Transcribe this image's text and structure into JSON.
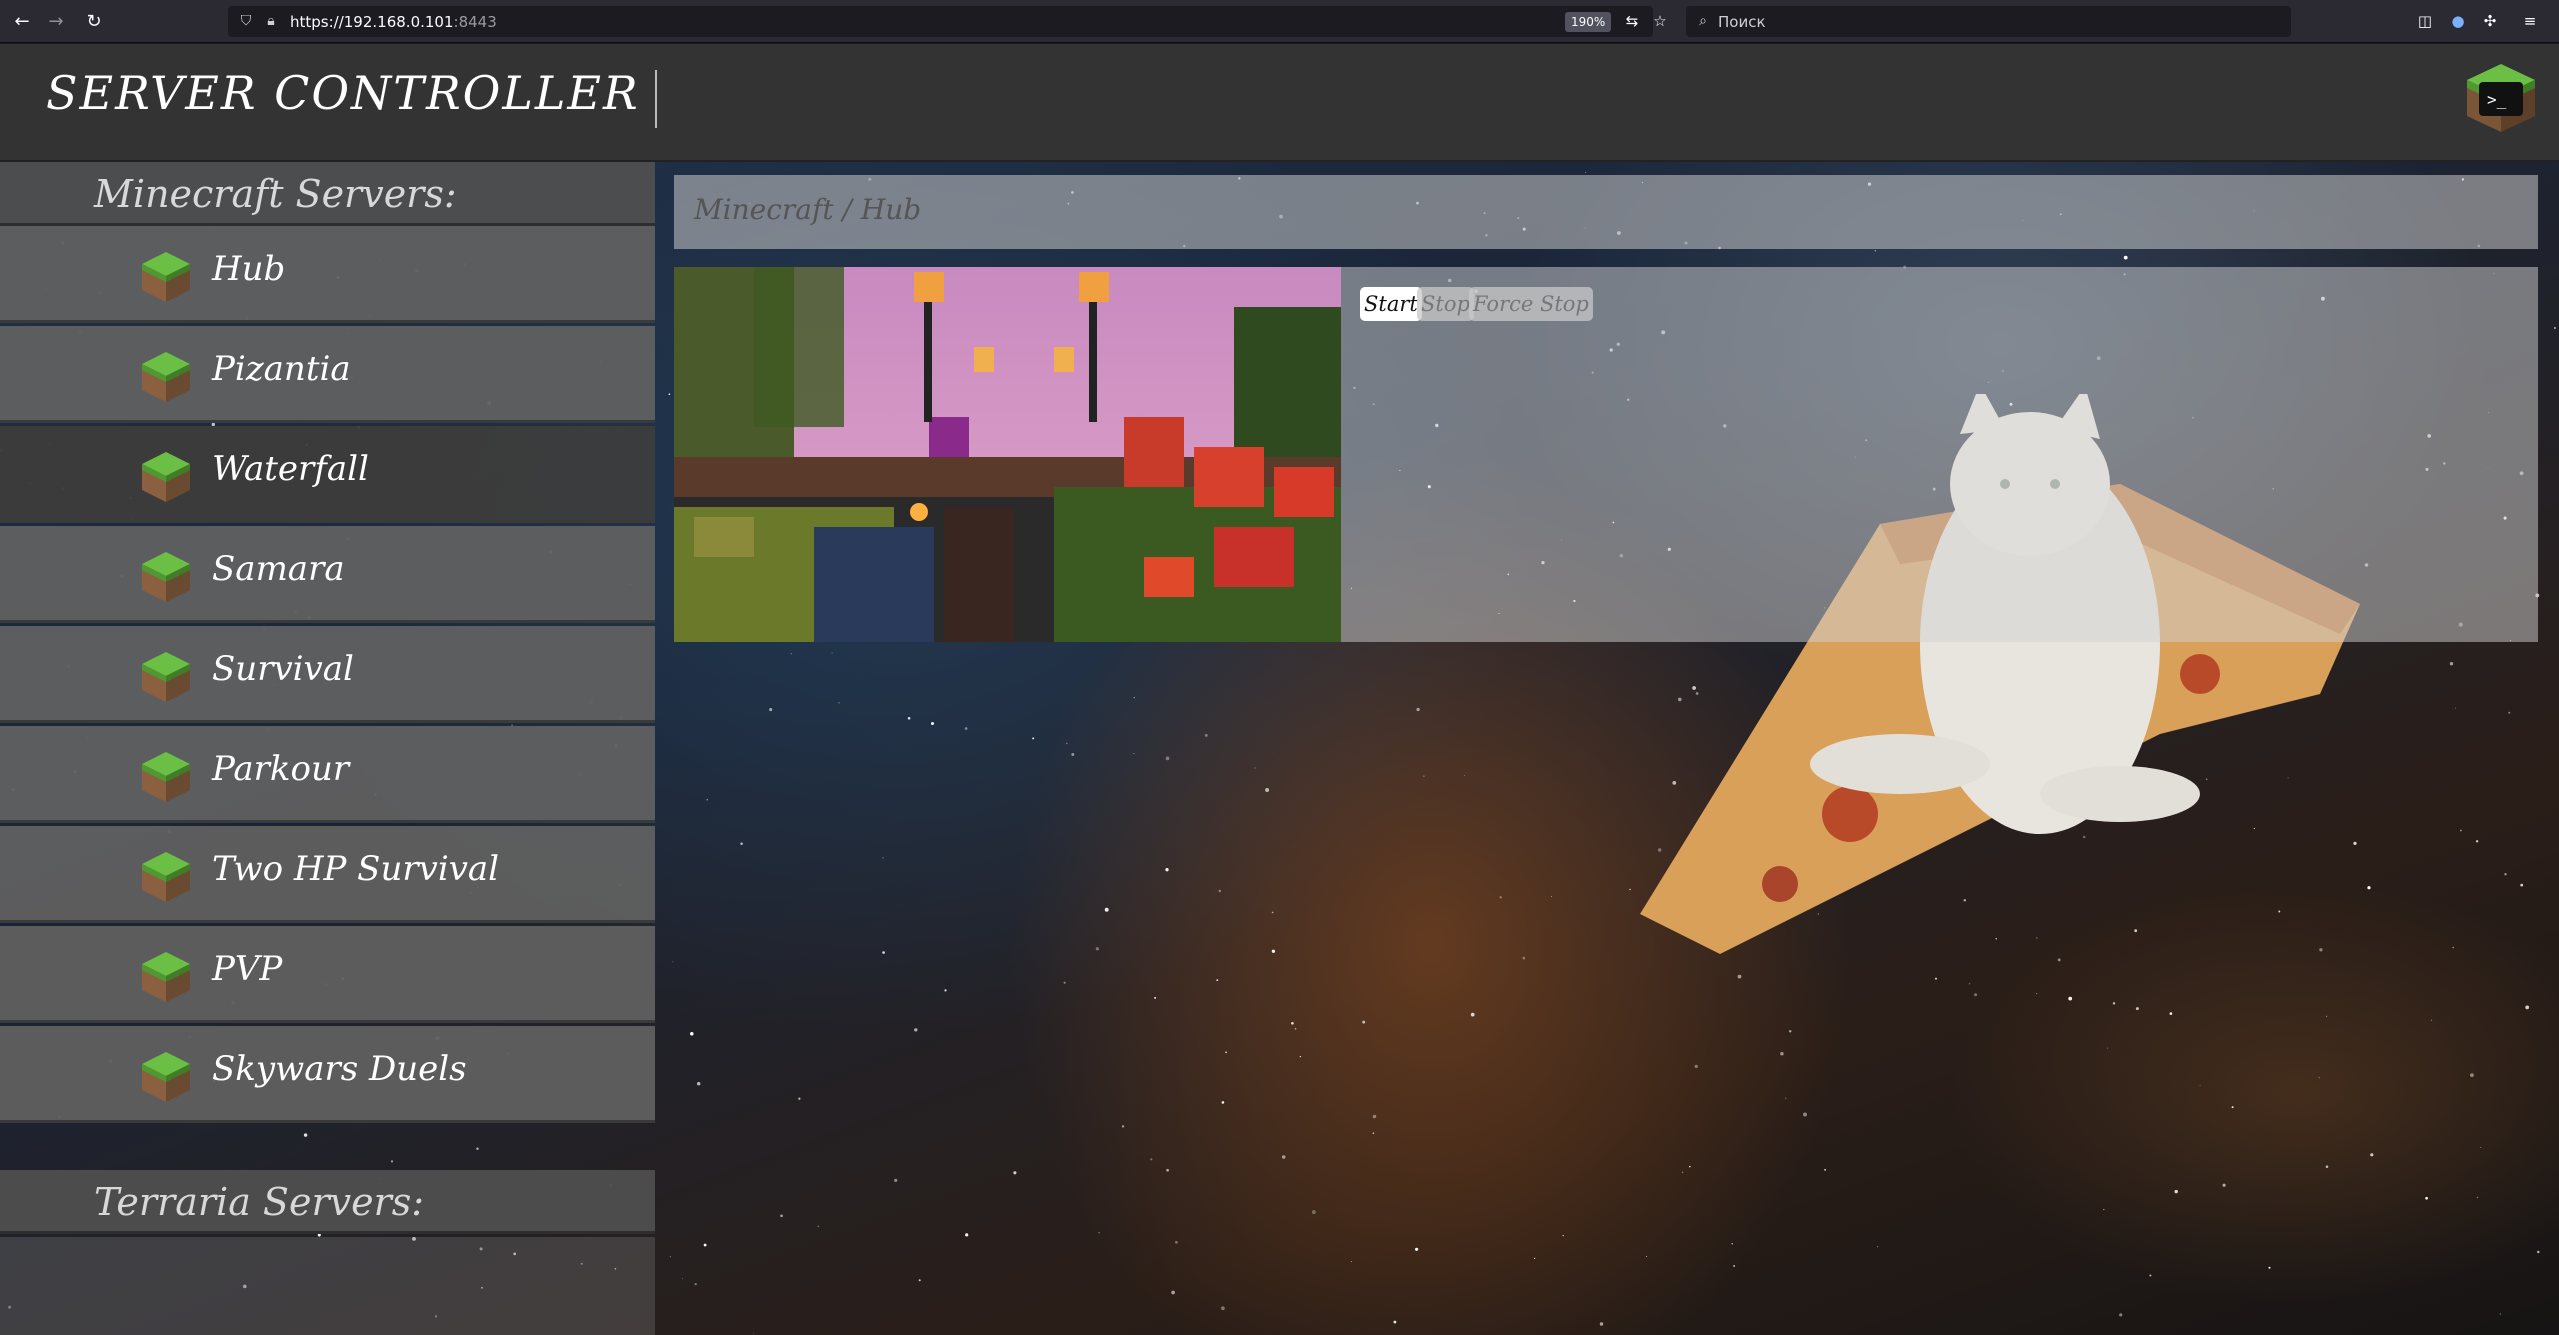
{
  "browser": {
    "url_host": "https://192.168.0.101",
    "url_port": ":8443",
    "zoom": "190%",
    "search_placeholder": "Поиск"
  },
  "header": {
    "title": "SERVER CONTROLLER",
    "console_icon": "terminal-icon"
  },
  "sidebar": {
    "minecraft_heading": "Minecraft Servers:",
    "servers": [
      {
        "label": "Hub"
      },
      {
        "label": "Pizantia"
      },
      {
        "label": "Waterfall"
      },
      {
        "label": "Samara"
      },
      {
        "label": "Survival"
      },
      {
        "label": "Parkour"
      },
      {
        "label": "Two HP Survival"
      },
      {
        "label": "PVP"
      },
      {
        "label": "Skywars Duels"
      }
    ],
    "terraria_heading": "Terraria Servers:"
  },
  "main": {
    "breadcrumb": "Minecraft / Hub",
    "buttons": {
      "start": "Start",
      "stop": "Stop",
      "force_stop": "Force Stop"
    }
  },
  "colors": {
    "header_bg": "#333333",
    "sidebar_item": "#606060",
    "sidebar_active": "#3c3c3c",
    "grass": "#5aa838",
    "dirt": "#7a5536"
  }
}
